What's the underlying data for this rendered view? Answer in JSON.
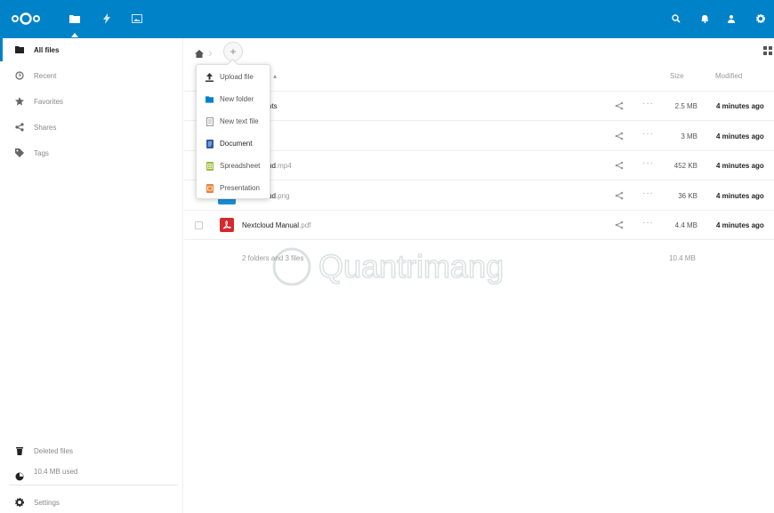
{
  "header": {
    "logo": "nextcloud-logo",
    "apps": [
      {
        "name": "files",
        "icon": "folder-icon"
      },
      {
        "name": "activity",
        "icon": "lightning-icon"
      },
      {
        "name": "gallery",
        "icon": "image-icon"
      }
    ],
    "right_icons": [
      "search-icon",
      "bell-icon",
      "contacts-icon",
      "settings-gear-icon"
    ],
    "color": "#0082c9"
  },
  "sidebar": {
    "items": [
      {
        "label": "All files",
        "icon": "folder-icon"
      },
      {
        "label": "Recent",
        "icon": "clock-icon"
      },
      {
        "label": "Favorites",
        "icon": "star-icon"
      },
      {
        "label": "Shares",
        "icon": "share-icon"
      },
      {
        "label": "Tags",
        "icon": "tag-icon"
      }
    ],
    "bottom": {
      "deleted": "Deleted files",
      "quota": "10.4 MB used",
      "settings": "Settings"
    }
  },
  "new_menu": {
    "items": [
      {
        "label": "Upload file",
        "icon": "upload-icon"
      },
      {
        "label": "New folder",
        "icon": "folder-icon"
      },
      {
        "label": "New text file",
        "icon": "text-file-icon"
      },
      {
        "label": "Document",
        "icon": "document-icon"
      },
      {
        "label": "Spreadsheet",
        "icon": "spreadsheet-icon"
      },
      {
        "label": "Presentation",
        "icon": "presentation-icon"
      }
    ]
  },
  "table": {
    "headers": {
      "sort_arrow": "▴",
      "size": "Size",
      "modified": "Modified"
    },
    "rows": [
      {
        "name": "nts",
        "ext": "",
        "size": "2.5 MB",
        "modified": "4 minutes ago"
      },
      {
        "name": "",
        "ext": "",
        "size": "3 MB",
        "modified": "4 minutes ago"
      },
      {
        "name": "ud",
        "ext": ".mp4",
        "size": "452 KB",
        "modified": "4 minutes ago"
      },
      {
        "name": "ud",
        "ext": ".png",
        "size": "36 KB",
        "modified": "4 minutes ago"
      },
      {
        "name": "Nextcloud Manual",
        "ext": ".pdf",
        "size": "4.4 MB",
        "modified": "4 minutes ago"
      }
    ],
    "more_glyph": "···",
    "summary_left": "2 folders and 3 files",
    "summary_size": "10.4 MB"
  },
  "add_button": "+",
  "watermark": "Quantrimang"
}
